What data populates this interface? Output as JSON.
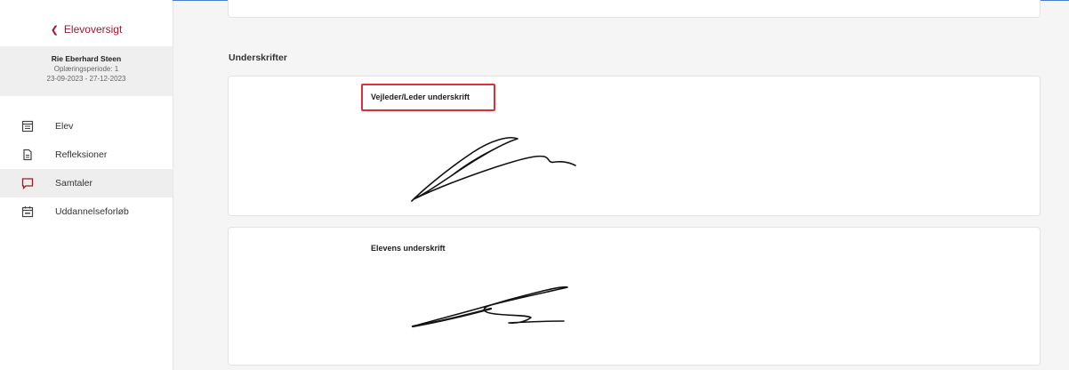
{
  "sidebar": {
    "back_label": "Elevoversigt",
    "student": {
      "name": "Rie Eberhard Steen",
      "period": "Oplæringsperiode: 1",
      "dates": "23-09-2023 - 27-12-2023"
    },
    "nav": [
      {
        "label": "Elev",
        "icon": "id-card-icon",
        "active": false
      },
      {
        "label": "Refleksioner",
        "icon": "document-icon",
        "active": false
      },
      {
        "label": "Samtaler",
        "icon": "chat-icon",
        "active": true
      },
      {
        "label": "Uddannelseforløb",
        "icon": "calendar-icon",
        "active": false
      }
    ]
  },
  "main": {
    "section_title": "Underskrifter",
    "signatures": [
      {
        "label": "Vejleder/Leder underskrift"
      },
      {
        "label": "Elevens underskrift"
      }
    ]
  },
  "colors": {
    "accent": "#a5162b",
    "highlight": "#d9303a",
    "topline": "#4f7fc9"
  }
}
